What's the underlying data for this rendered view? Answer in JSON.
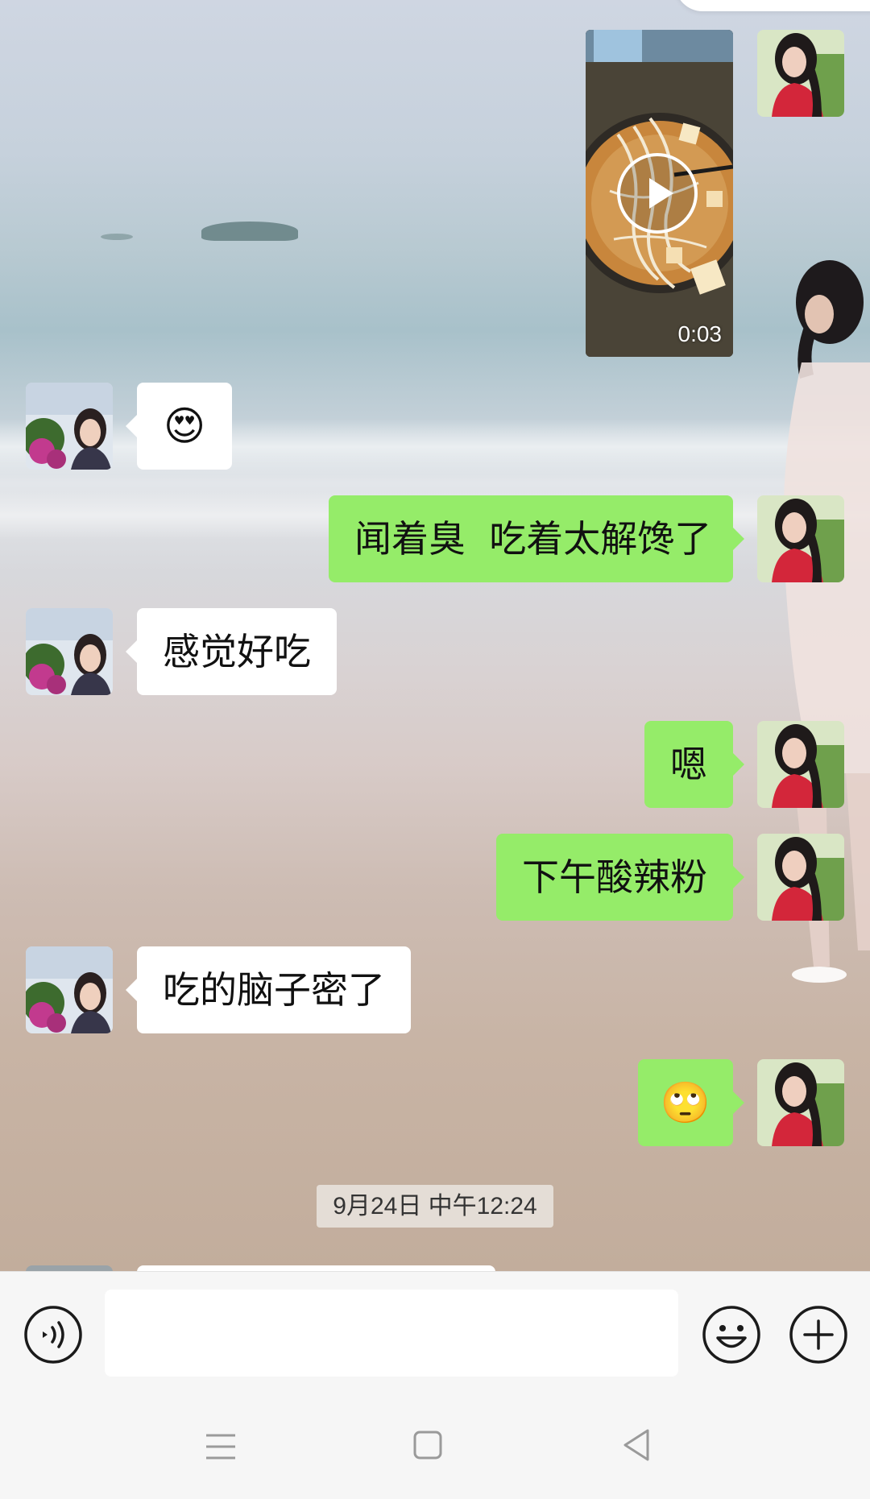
{
  "messages": [
    {
      "side": "right",
      "type": "video",
      "duration": "0:03",
      "icon": "play-icon"
    },
    {
      "side": "left",
      "type": "emoji",
      "emoji": "😍"
    },
    {
      "side": "right",
      "type": "text",
      "text": "闻着臭  吃着太解馋了"
    },
    {
      "side": "left",
      "type": "text",
      "text": "感觉好吃"
    },
    {
      "side": "right",
      "type": "text",
      "text": "嗯"
    },
    {
      "side": "right",
      "type": "text",
      "text": "下午酸辣粉"
    },
    {
      "side": "left",
      "type": "text",
      "text": "吃的脑子密了"
    },
    {
      "side": "right",
      "type": "emoji",
      "emoji": "🙄"
    }
  ],
  "timestamp": "9月24日 中午12:24",
  "input_bar": {
    "voice_icon": "voice-icon",
    "input_value": "",
    "emoji_icon": "emoji-icon",
    "plus_icon": "plus-icon"
  },
  "nav_bar": {
    "menu_icon": "menu-icon",
    "home_icon": "home-icon",
    "back_icon": "back-icon"
  },
  "colors": {
    "sent_bubble": "#95ec69",
    "received_bubble": "#ffffff",
    "bar_background": "#f6f6f6"
  }
}
